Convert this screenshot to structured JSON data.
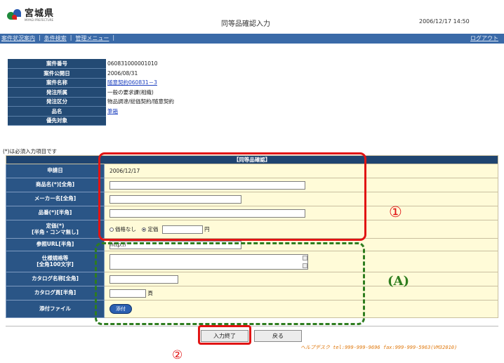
{
  "header": {
    "logo_title": "宮城県",
    "logo_sub": "MIYAGI PREFECTURE",
    "page_title": "同等品確認入力",
    "datetime": "2006/12/17 14:50"
  },
  "nav": {
    "items": [
      "案件状況案内",
      "条件検索",
      "管理メニュー"
    ],
    "separator": "|",
    "logout": "ログアウト"
  },
  "case_info": [
    {
      "label": "案件番号",
      "value": "060831000001010",
      "link": false
    },
    {
      "label": "案件公開日",
      "value": "2006/08/31",
      "link": false
    },
    {
      "label": "案件名称",
      "value": "随意契約060831－3",
      "link": true
    },
    {
      "label": "発注所属",
      "value": "一般の要求課(相織)",
      "link": false
    },
    {
      "label": "発注区分",
      "value": "物品調達/総価契約/随意契約",
      "link": false
    },
    {
      "label": "品名",
      "value": "筆箱",
      "link": true
    },
    {
      "label": "優先対象",
      "value": "",
      "link": false
    }
  ],
  "required_note": "(*)は必須入力項目です",
  "form": {
    "caption": "【同等品確認】",
    "rows": {
      "apply_date": {
        "label": "申請日",
        "value": "2006/12/17"
      },
      "product_name": {
        "label": "商品名(*)[全角]",
        "value": ""
      },
      "maker_name": {
        "label": "メーカー名[全角]",
        "value": ""
      },
      "product_number": {
        "label": "品番(*)[半角]",
        "value": ""
      },
      "price": {
        "label_line1": "定価(*)",
        "label_line2": "[半角・コンマ無し]",
        "option_none": "価格なし",
        "option_fixed": "定価",
        "selected": "定価",
        "value": "",
        "unit": "円"
      },
      "ref_url": {
        "label": "参照URL[半角]",
        "value": "http://"
      },
      "spec": {
        "label_line1": "仕様規格等",
        "label_line2": "[全角100文字]",
        "value": ""
      },
      "catalog_name": {
        "label": "カタログ名称[全角]",
        "value": ""
      },
      "catalog_page": {
        "label": "カタログ頁[半角]",
        "value": "",
        "unit": "頁"
      },
      "attachment": {
        "label": "添付ファイル",
        "button": "添付"
      }
    }
  },
  "buttons": {
    "submit": "入力終了",
    "back": "戻る"
  },
  "helpdesk": "ヘルプデスク tel:999-999-9696 fax:999-999-5963(VM32010)",
  "annotations": {
    "marker_1": "①",
    "marker_2": "②",
    "marker_a": "(A)"
  },
  "colors": {
    "nav_bar": "#3a6aa8",
    "label_bg": "#2a5586",
    "field_bg": "#fffbd8",
    "annotation_red": "#e11414",
    "annotation_green": "#2e7d1f",
    "helpdesk_text": "#e07a10"
  }
}
